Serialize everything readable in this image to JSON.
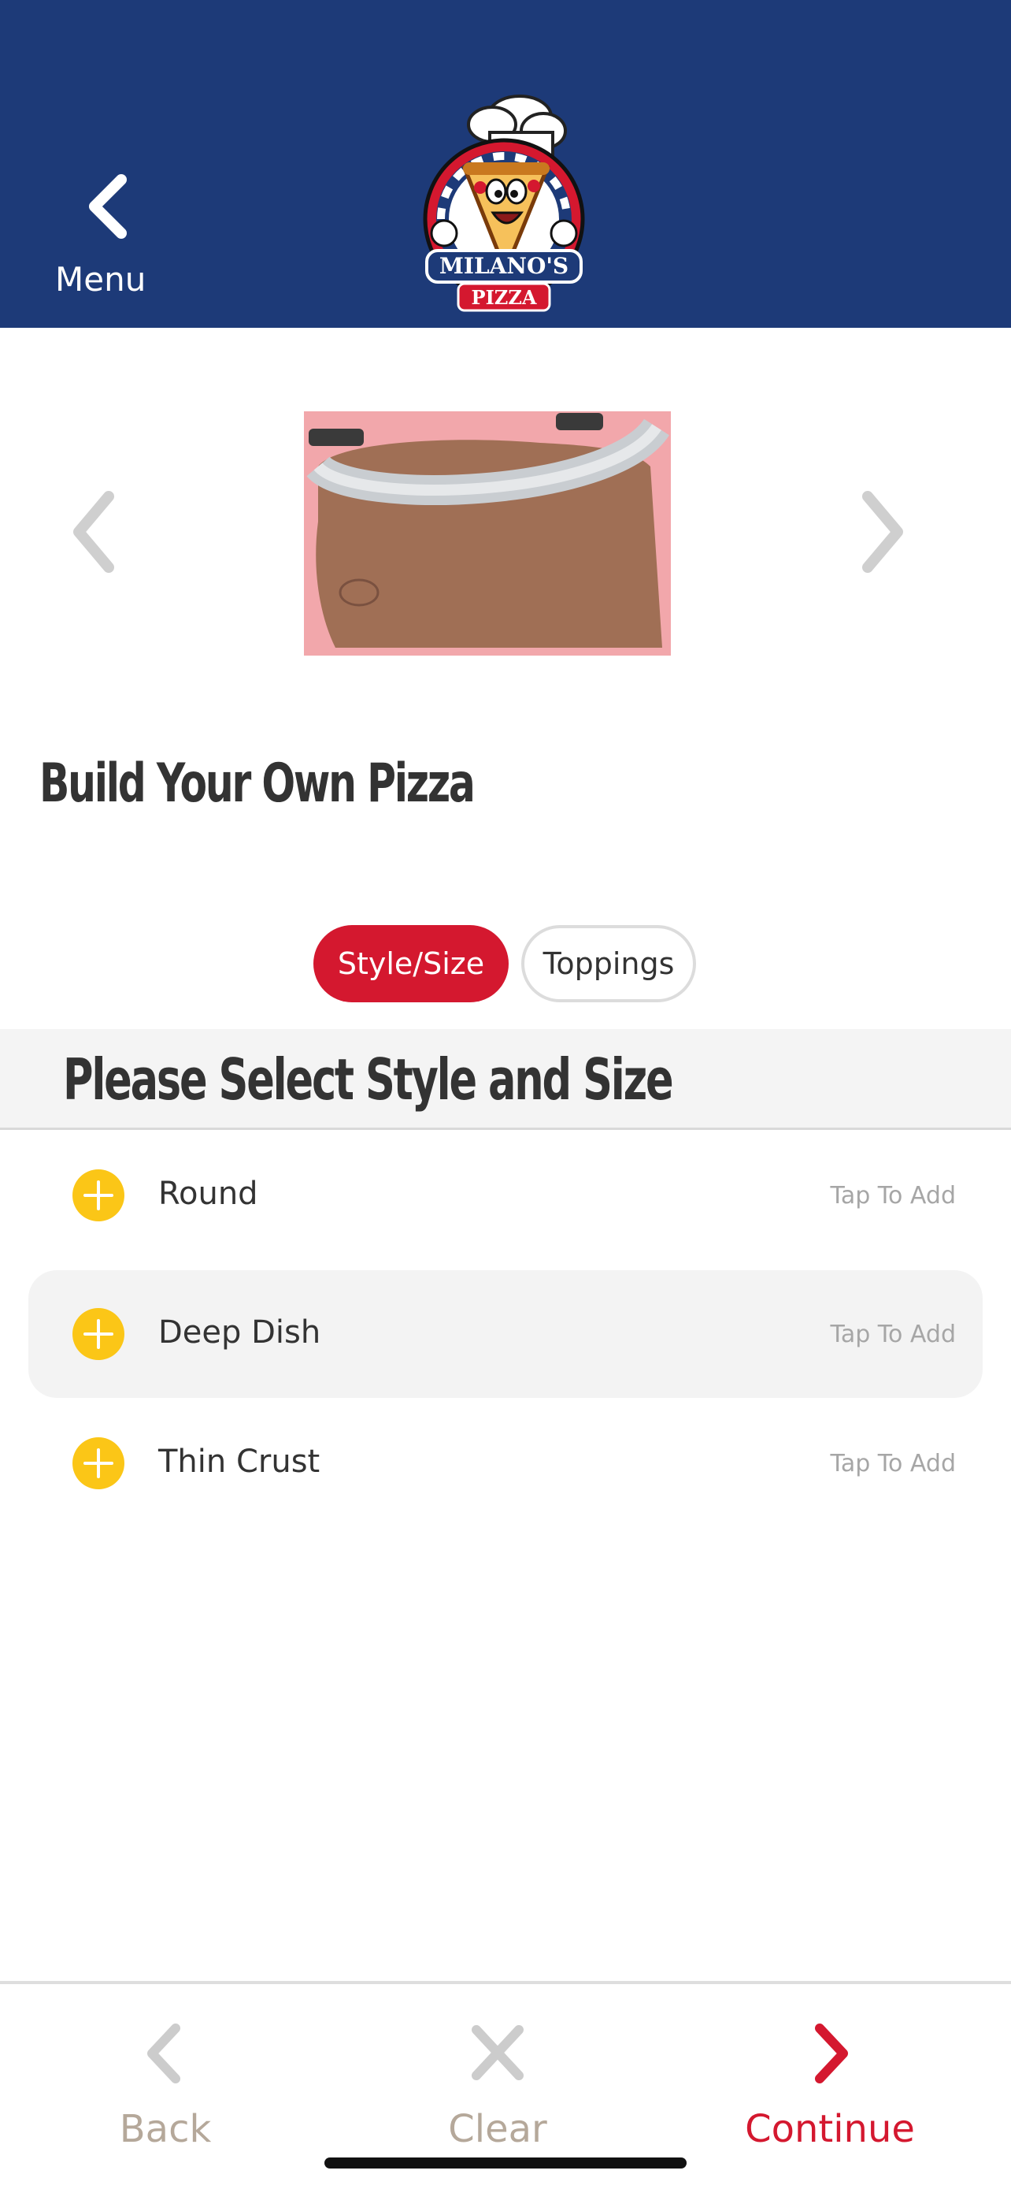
{
  "header": {
    "menu_label": "Menu",
    "logo_text": "MILANO'S PIZZA",
    "bg_color": "#1d3a78"
  },
  "item": {
    "title": "Build Your Own Pizza"
  },
  "tabs": [
    {
      "label": "Style/Size",
      "active": true
    },
    {
      "label": "Toppings",
      "active": false
    }
  ],
  "section": {
    "title": "Please Select Style and Size"
  },
  "options": [
    {
      "name": "Round",
      "hint": "Tap To Add",
      "icon": "plus-circle-icon"
    },
    {
      "name": "Deep Dish",
      "hint": "Tap To Add",
      "icon": "plus-circle-icon"
    },
    {
      "name": "Thin Crust",
      "hint": "Tap To Add",
      "icon": "plus-circle-icon"
    }
  ],
  "footer": {
    "back_label": "Back",
    "clear_label": "Clear",
    "continue_label": "Continue"
  },
  "colors": {
    "accent_red": "#d4182f",
    "add_yellow": "#fbc617",
    "footer_muted": "#b5a89a"
  }
}
